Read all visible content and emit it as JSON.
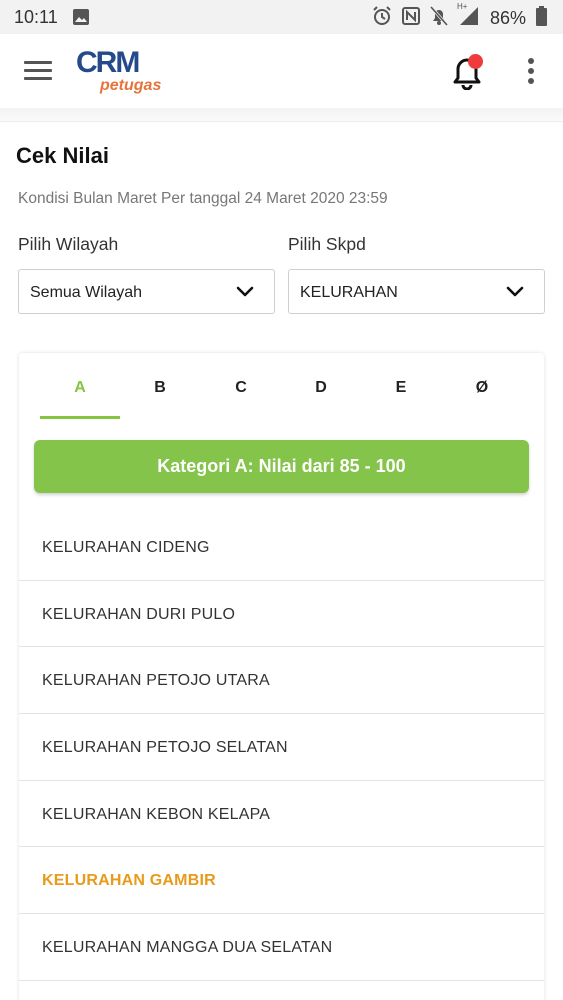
{
  "status_bar": {
    "time": "10:11",
    "battery_percent": "86%",
    "network_label": "H+"
  },
  "app": {
    "logo_text": "CRM",
    "logo_subtext": "petugas"
  },
  "page": {
    "title": "Cek Nilai",
    "subtitle": "Kondisi Bulan Maret Per tanggal 24 Maret 2020 23:59"
  },
  "filters": {
    "wilayah_label": "Pilih Wilayah",
    "wilayah_value": "Semua Wilayah",
    "skpd_label": "Pilih Skpd",
    "skpd_value": "KELURAHAN"
  },
  "tabs": [
    "A",
    "B",
    "C",
    "D",
    "E",
    "Ø"
  ],
  "active_tab": "A",
  "category_banner": "Kategori A: Nilai dari 85 - 100",
  "items": [
    "KELURAHAN CIDENG",
    "KELURAHAN DURI PULO",
    "KELURAHAN PETOJO UTARA",
    "KELURAHAN PETOJO SELATAN",
    "KELURAHAN KEBON KELAPA",
    "KELURAHAN GAMBIR",
    "KELURAHAN MANGGA DUA SELATAN"
  ],
  "highlighted_item": "KELURAHAN GAMBIR",
  "colors": {
    "accent_green": "#86c540",
    "highlight_orange": "#e89a1a",
    "notification_dot": "#ef3b3b",
    "logo_blue": "#244a8a",
    "logo_orange": "#e8743b"
  },
  "icons": [
    "image-icon",
    "alarm-icon",
    "nfc-icon",
    "mute-notifications-icon",
    "signal-icon",
    "battery-icon",
    "menu-icon",
    "bell-icon",
    "more-vert-icon",
    "chevron-down-icon"
  ]
}
